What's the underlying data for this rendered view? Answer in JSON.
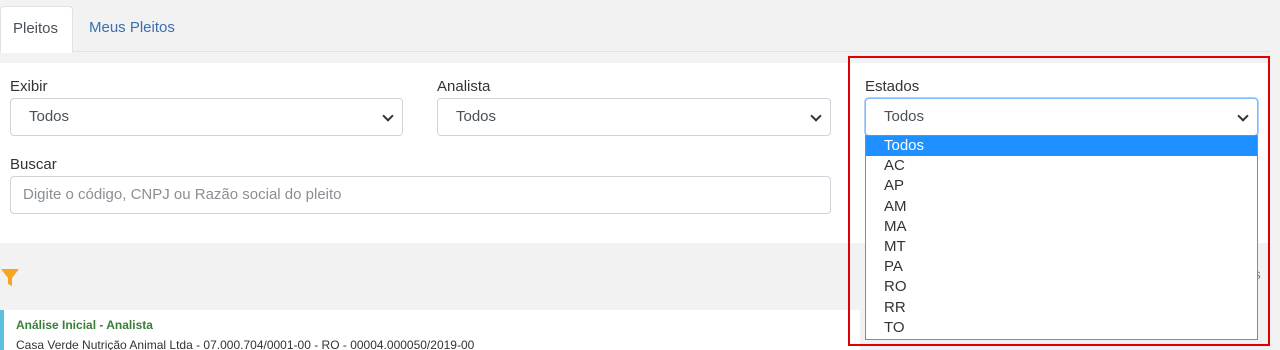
{
  "tabs": [
    {
      "label": "Pleitos",
      "active": true
    },
    {
      "label": "Meus Pleitos",
      "active": false
    }
  ],
  "filters": {
    "exibir": {
      "label": "Exibir",
      "value": "Todos"
    },
    "analista": {
      "label": "Analista",
      "value": "Todos"
    },
    "estados": {
      "label": "Estados",
      "value": "Todos",
      "options": [
        "Todos",
        "AC",
        "AP",
        "AM",
        "MA",
        "MT",
        "PA",
        "RO",
        "RR",
        "TO"
      ],
      "selected_index": 0
    },
    "buscar": {
      "label": "Buscar",
      "placeholder": "Digite o código, CNPJ ou Razão social do pleito"
    }
  },
  "results": {
    "side_text": "os",
    "card": {
      "title": "Análise Inicial - Analista",
      "subtitle": "Casa Verde Nutrição Animal Ltda - 07.000.704/0001-00 - RO - 00004.000050/2019-00"
    }
  },
  "colors": {
    "highlight": "#e00000",
    "tab_link": "#3a6fb0",
    "selected_option": "#1e90ff",
    "filter_icon": "#f5a623",
    "card_accent": "#5bc0de"
  }
}
